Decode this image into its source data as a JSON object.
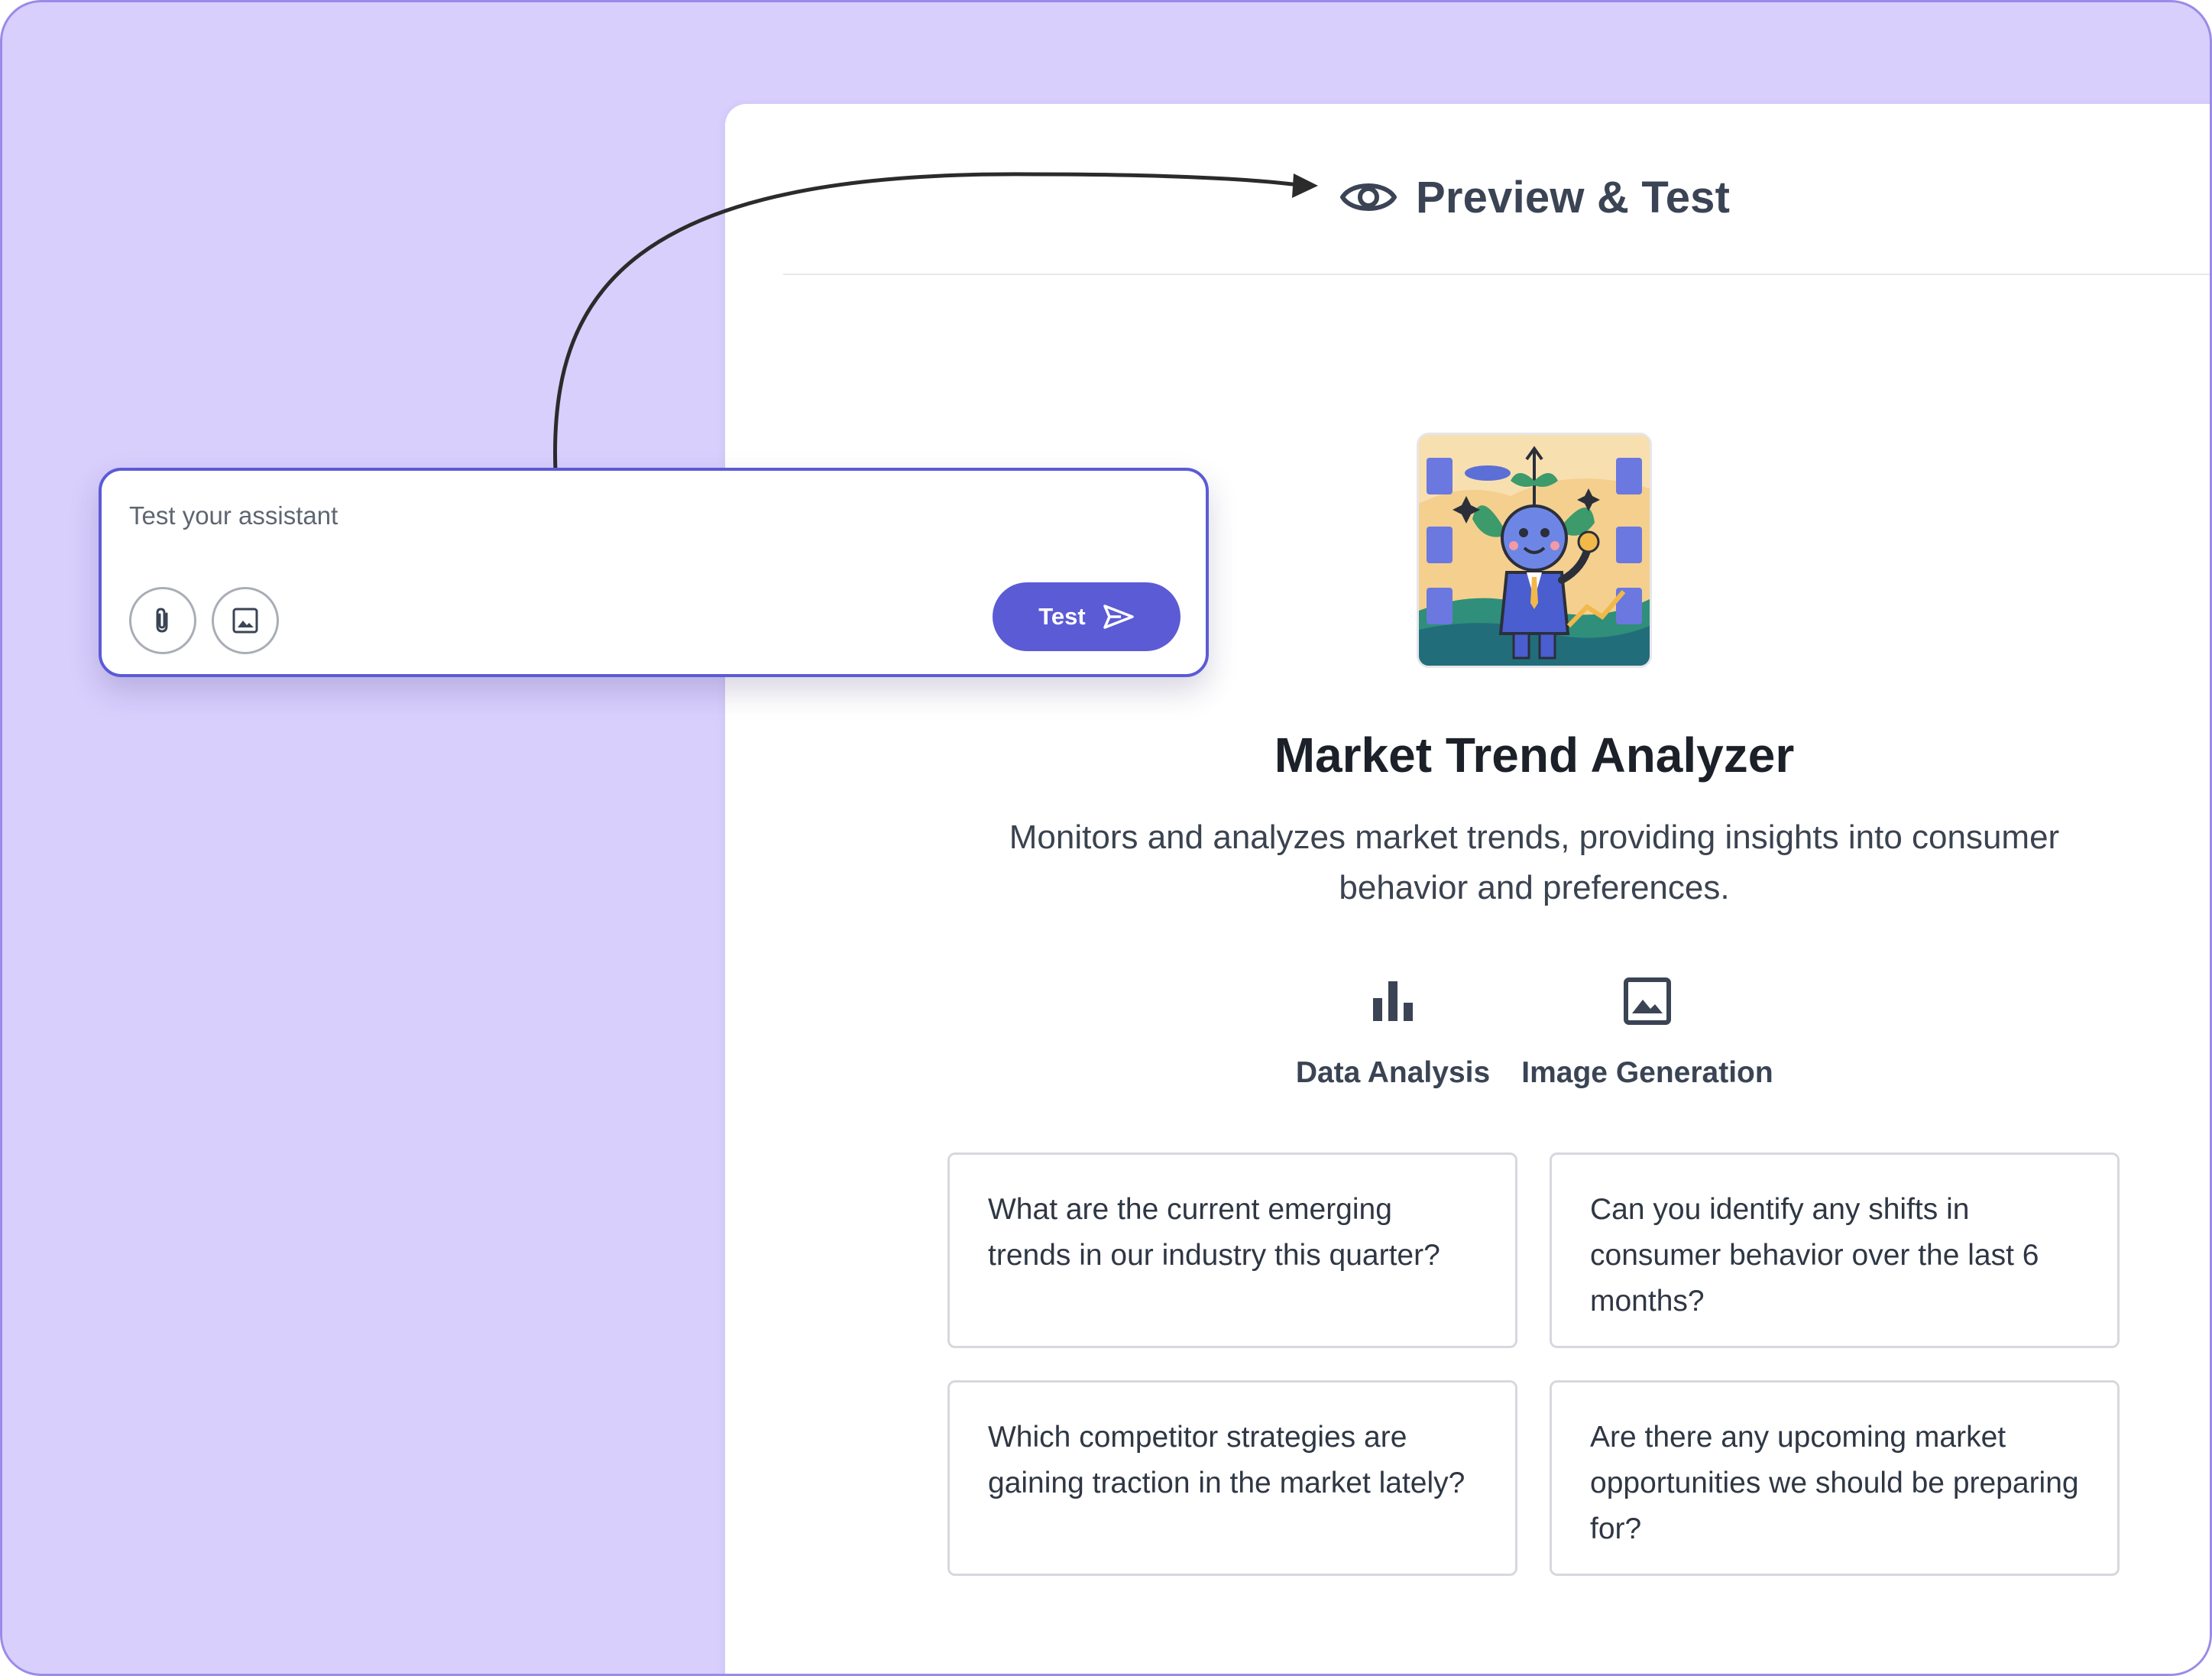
{
  "preview": {
    "title": "Preview & Test",
    "icon": "eye-icon"
  },
  "assistant": {
    "name": "Market Trend Analyzer",
    "description": "Monitors and analyzes market trends, providing insights into consumer behavior and preferences.",
    "avatar_icon": "assistant-avatar-illustration"
  },
  "capabilities": [
    {
      "label": "Data Analysis",
      "icon": "bar-chart-icon"
    },
    {
      "label": "Image Generation",
      "icon": "image-icon"
    }
  ],
  "prompts": [
    "What are the current emerging trends in our industry this quarter?",
    "Can you identify any shifts in consumer behavior over the last 6 months?",
    "Which competitor strategies are gaining traction in the market lately?",
    "Are there any upcoming market opportunities we should be preparing for?"
  ],
  "test_input": {
    "placeholder": "Test your assistant",
    "attach_icon": "paperclip-icon",
    "image_icon": "image-icon",
    "button_label": "Test",
    "send_icon": "send-icon"
  },
  "colors": {
    "accent": "#5b5bd6",
    "background": "#d8cffd",
    "border": "#9a8be8"
  }
}
